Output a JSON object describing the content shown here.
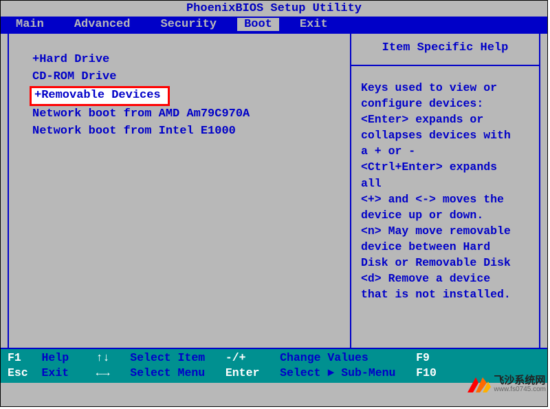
{
  "title": "PhoenixBIOS Setup Utility",
  "menu": {
    "items": [
      "Main",
      "Advanced",
      "Security",
      "Boot",
      "Exit"
    ],
    "active_index": 3
  },
  "boot_order": {
    "items": [
      {
        "label": "+Hard Drive",
        "highlighted": false
      },
      {
        "label": " CD-ROM Drive",
        "highlighted": false
      },
      {
        "label": "+Removable Devices",
        "highlighted": true
      },
      {
        "label": " Network boot from AMD Am79C970A",
        "highlighted": false
      },
      {
        "label": " Network boot from Intel E1000",
        "highlighted": false
      }
    ]
  },
  "help": {
    "title": "Item Specific Help",
    "body": "Keys used to view or\nconfigure devices:\n<Enter> expands or\ncollapses devices with\na + or -\n<Ctrl+Enter> expands\nall\n<+> and <-> moves the\ndevice up or down.\n<n> May move removable\ndevice between Hard\nDisk or Removable Disk\n<d> Remove a device\nthat is not installed."
  },
  "footer": {
    "rows": [
      [
        {
          "key": "F1",
          "label": "Help"
        },
        {
          "key": "↑↓",
          "label": "Select Item"
        },
        {
          "key": "-/+",
          "label": "Change Values"
        },
        {
          "key": "F9",
          "label": ""
        }
      ],
      [
        {
          "key": "Esc",
          "label": "Exit"
        },
        {
          "key": "←→",
          "label": "Select Menu"
        },
        {
          "key": "Enter",
          "label": "Select ► Sub-Menu"
        },
        {
          "key": "F10",
          "label": ""
        }
      ]
    ]
  },
  "watermark": {
    "title": "飞沙系统网",
    "url": "www.fs0745.com"
  }
}
